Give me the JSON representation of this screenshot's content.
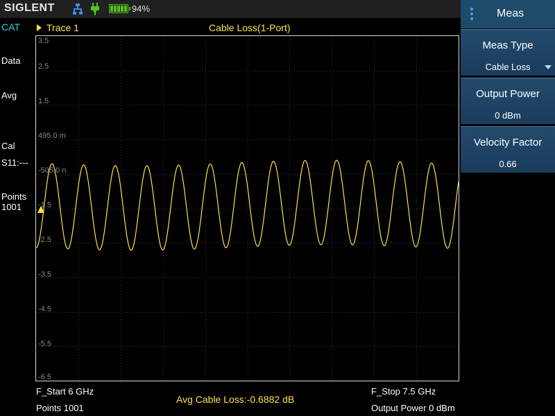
{
  "status": {
    "brand": "SIGLENT",
    "battery_pct": "94%",
    "icons": [
      "network-icon",
      "power-plug-icon",
      "battery-icon"
    ],
    "accent": "#52c41a"
  },
  "side": {
    "cat": "CAT",
    "data": "Data",
    "avg": "Avg",
    "cal": "Cal",
    "s11": "S11:---",
    "points_label": "Points",
    "points_value": "1001"
  },
  "trace": {
    "label": "Trace 1",
    "title": "Cable Loss(1-Port)",
    "color": "#ffe24d"
  },
  "plot": {
    "y_ticks": [
      "3.5",
      "2.5",
      "1.5",
      "495.0 m",
      "-505.0 n",
      "-1.5",
      "-2.5",
      "-3.5",
      "-4.5",
      "-5.5",
      "-6.5"
    ]
  },
  "footer": {
    "start": "F_Start  6 GHz",
    "points": "Points  1001",
    "avg_loss": "Avg Cable Loss:-0.6882 dB",
    "stop": "F_Stop  7.5 GHz",
    "output_power": "Output Power  0 dBm"
  },
  "panel": {
    "title": "Meas",
    "keys": [
      {
        "label": "Meas Type",
        "value": "Cable Loss"
      },
      {
        "label": "Output Power",
        "value": "0 dBm"
      },
      {
        "label": "Velocity Factor",
        "value": "0.66"
      }
    ]
  }
}
